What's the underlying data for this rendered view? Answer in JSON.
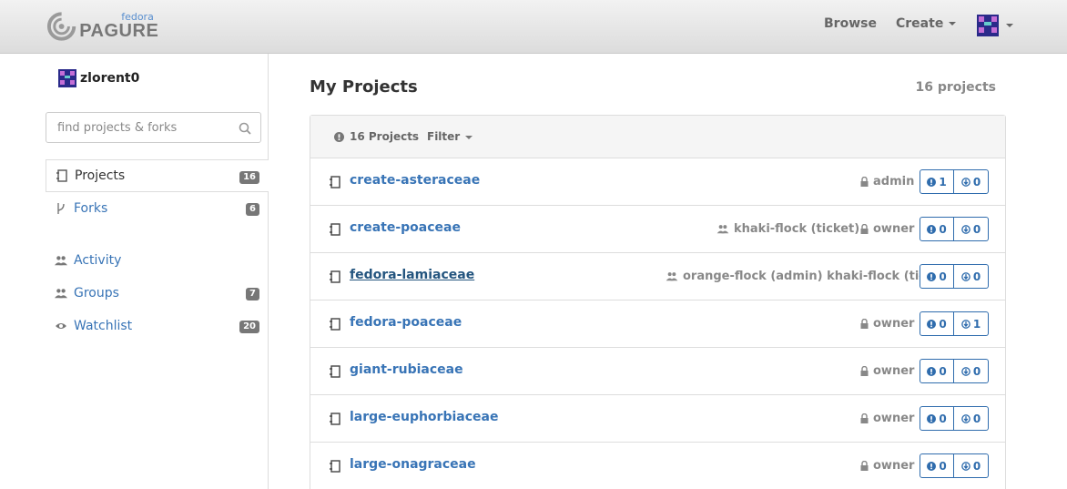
{
  "header": {
    "logo_top": "fedora",
    "logo_main": "PAGURE",
    "nav_browse": "Browse",
    "nav_create": "Create"
  },
  "sidebar": {
    "username": "zlorent0",
    "search_placeholder": "find projects & forks",
    "items": [
      {
        "label": "Projects",
        "badge": "16"
      },
      {
        "label": "Forks",
        "badge": "6"
      },
      {
        "label": "Activity",
        "badge": ""
      },
      {
        "label": "Groups",
        "badge": "7"
      },
      {
        "label": "Watchlist",
        "badge": "20"
      }
    ]
  },
  "main": {
    "title": "My Projects",
    "count": "16 projects",
    "panel_count": "16 Projects",
    "filter_label": "Filter",
    "projects": [
      {
        "name": "create-asteraceae",
        "groups": "",
        "role": "admin",
        "issues": "1",
        "prs": "0"
      },
      {
        "name": "create-poaceae",
        "groups": "khaki-flock (ticket)",
        "role": "owner",
        "issues": "0",
        "prs": "0"
      },
      {
        "name": "fedora-lamiaceae",
        "groups": "orange-flock (admin) khaki-flock (ticket)",
        "role": "",
        "issues": "0",
        "prs": "0"
      },
      {
        "name": "fedora-poaceae",
        "groups": "",
        "role": "owner",
        "issues": "0",
        "prs": "1"
      },
      {
        "name": "giant-rubiaceae",
        "groups": "",
        "role": "owner",
        "issues": "0",
        "prs": "0"
      },
      {
        "name": "large-euphorbiaceae",
        "groups": "",
        "role": "owner",
        "issues": "0",
        "prs": "0"
      },
      {
        "name": "large-onagraceae",
        "groups": "",
        "role": "owner",
        "issues": "0",
        "prs": "0"
      }
    ]
  },
  "colors": {
    "link": "#3874b6",
    "button_border": "#2f6cad",
    "badge": "#777777"
  }
}
